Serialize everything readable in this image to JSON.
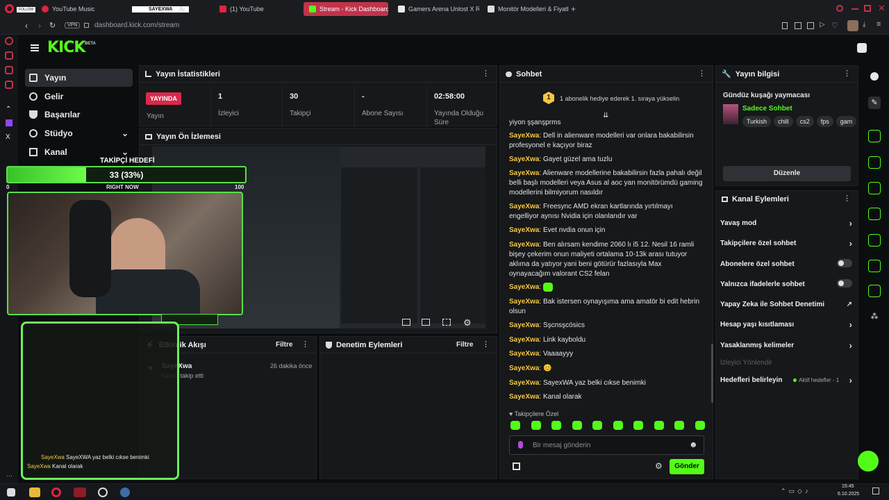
{
  "browser": {
    "tabs": [
      {
        "label": "YouTube Music"
      },
      {
        "label": "Ai"
      },
      {
        "label": "(1) YouTube"
      },
      {
        "label": "Stream - Kick Dashboard"
      },
      {
        "label": "Gamers Arena Unlost X R"
      },
      {
        "label": "Monitör Modelleri & Fiyatl"
      }
    ],
    "url": "dashboard.kick.com/stream",
    "vpn_label": "VPN",
    "follow_label": "FOLLOW",
    "username_overlay": "SAYEXWA"
  },
  "header": {
    "logo": "KICK",
    "beta": "BETA"
  },
  "nav": {
    "items": [
      {
        "label": "Yayın",
        "icon": "broadcast-icon"
      },
      {
        "label": "Gelir",
        "icon": "dollar-icon"
      },
      {
        "label": "Başarılar",
        "icon": "trophy-icon"
      },
      {
        "label": "Stüdyo",
        "icon": "studio-icon"
      },
      {
        "label": "Kanal",
        "icon": "channel-icon"
      }
    ]
  },
  "stats": {
    "title": "Yayın İstatistikleri",
    "live_badge": "YAYINDA",
    "live_label": "Yayın",
    "viewers_value": "1",
    "viewers_label": "İzleyici",
    "followers_value": "30",
    "followers_label": "Takipçi",
    "subs_value": "-",
    "subs_label": "Abone Sayısı",
    "duration_value": "02:58:00",
    "duration_label": "Yayında Olduğu Süre"
  },
  "preview": {
    "title": "Yayın Ön İzlemesi"
  },
  "goal": {
    "title": "TAKİPÇİ HEDEFİ",
    "progress_text": "33 (33%)",
    "fraction": 0.33,
    "min": "0",
    "max": "100",
    "sub": "RIGHT NOW"
  },
  "activity": {
    "title": "Etkinlik Akışı",
    "filter": "Filtre",
    "event_user": "SayeXwa",
    "event_action": "kanalı takip etti",
    "event_time": "26 dakika önce"
  },
  "moderation": {
    "title": "Denetim Eylemleri",
    "filter": "Filtre"
  },
  "chat": {
    "title": "Sohbet",
    "pinned_count": "1",
    "pinned_text": "1 abonelik hediye ederek 1. sıraya yükselin",
    "partial_text": "yiyon şşanşprms",
    "messages": [
      {
        "user": "SayeXwa",
        "text": "Dell in alienware modelleri var onlara bakabilirsin profesyonel e kaçıyor biraz"
      },
      {
        "user": "SayeXwa",
        "text": "Gayet güzel ama tuzlu"
      },
      {
        "user": "SayeXwa",
        "text": "Alienware modellerine bakabilirsin fazla pahalı değil belli başlı modelleri veya Asus al aoc yan monitörümdü gaming modellerini bilmiyorum nasıldır"
      },
      {
        "user": "SayeXwa",
        "text": "Freesync AMD ekran kartlarında yırtılmayı engelliyor aynısı Nvidia için olanlarıdır var"
      },
      {
        "user": "SayeXwa",
        "text": "Evet nvdia onun için"
      },
      {
        "user": "SayeXwa",
        "text": "Ben alırsam kendime 2060 lı i5 12. Nesil 16 ramli bişey çekerim onun maliyeti ortalama 10-13k arası tutuyor aklıma da yatıyor yani beni götürür fazlasıyla Max oynayacağım valorant CS2 felan"
      },
      {
        "user": "SayeXwa",
        "text": ""
      },
      {
        "user": "SayeXwa",
        "text": "Bak istersen oynayışıma ama amatör bi edit hebrin olsun"
      },
      {
        "user": "SayeXwa",
        "text": "Sşcnsşcösics"
      },
      {
        "user": "SayeXwa",
        "text": "Link kayboldu"
      },
      {
        "user": "SayeXwa",
        "text": "Vaaaayyy"
      },
      {
        "user": "SayeXwa",
        "text": "😊"
      },
      {
        "user": "SayeXwa",
        "text": "SayexWA yaz belki cıkse benimki"
      },
      {
        "user": "SayeXwa",
        "text": "Kanal olarak"
      }
    ],
    "followers_only_label": "Takipçilere Özel",
    "input_placeholder": "Bir mesaj gönderin",
    "send_label": "Gönder"
  },
  "overlay_chat": {
    "lines": [
      {
        "user": "SayeXwa",
        "text": "SayeXWA yaz belki cıkse benimki"
      },
      {
        "user": "SayeXwa",
        "text": "Kanal olarak"
      }
    ]
  },
  "stream_info": {
    "title": "Yayın bilgisi",
    "stream_title": "Gündüz kuşağı yaymacası",
    "category": "Sadece Sohbet",
    "tags": [
      "Turkish",
      "chill",
      "cs2",
      "fps",
      "gam"
    ],
    "edit_label": "Düzenle"
  },
  "channel_actions": {
    "title": "Kanal Eylemleri",
    "items": [
      {
        "label": "Yavaş mod",
        "control": "chevron"
      },
      {
        "label": "Takipçilere özel sohbet",
        "control": "chevron"
      },
      {
        "label": "Abonelere özel sohbet",
        "control": "toggle"
      },
      {
        "label": "Yalnızca ifadelerle sohbet",
        "control": "toggle"
      },
      {
        "label": "Yapay Zeka ile Sohbet Denetimi",
        "control": "external"
      },
      {
        "label": "Hesap yaşı kısıtlaması",
        "control": "chevron"
      },
      {
        "label": "Yasaklanmış kelimeler",
        "control": "chevron"
      }
    ],
    "disabled_label": "İzleyici Yönlendir",
    "goals_label": "Hedefleri belirleyin",
    "goals_status": "Aktif hedefler - 1"
  },
  "taskbar": {
    "time": "15:45",
    "date": "6.10.2025"
  },
  "colors": {
    "kick_green": "#53fc18",
    "live_red": "#d9294b",
    "chat_user": "#f6c744"
  }
}
